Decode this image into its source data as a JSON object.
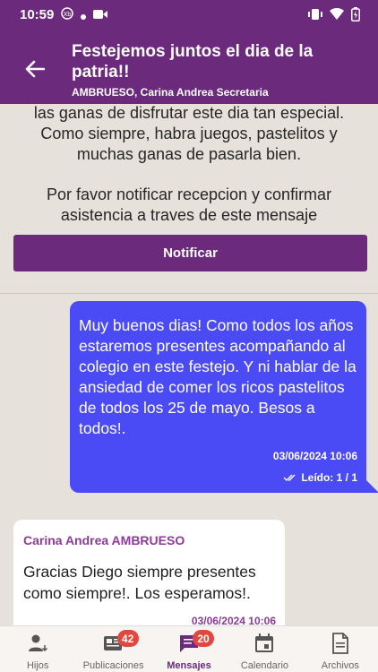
{
  "status_bar": {
    "time": "10:59"
  },
  "header": {
    "title": "Festejemos juntos el dia de la patria!!",
    "subtitle": "AMBRUESO, Carina Andrea Secretaria"
  },
  "announcement": {
    "text_partial": "las ganas de disfrutar este dia tan especial. Como siempre, habra juegos, pastelitos y muchas ganas de pasarla bien.",
    "text_request": "Por favor notificar recepcion y confirmar asistencia a traves de este mensaje",
    "notify_button_label": "Notificar"
  },
  "messages": [
    {
      "direction": "outgoing",
      "text": "Muy buenos dias! Como todos los años estaremos presentes acompañando al colegio en este festejo. Y ni hablar de la ansiedad de comer los ricos pastelitos de todos los 25 de mayo. Besos a todos!.",
      "date": "03/06/2024 10:06",
      "read_status": "Leído: 1 / 1"
    },
    {
      "direction": "incoming",
      "sender": "Carina Andrea AMBRUESO",
      "text": "Gracias Diego siempre presentes como siempre!. Los esperamos!.",
      "date": "03/06/2024 10:06"
    }
  ],
  "bottom_nav": [
    {
      "label": "Hijos",
      "icon": "child-user-icon",
      "active": false
    },
    {
      "label": "Publicaciones",
      "icon": "newspaper-icon",
      "badge": "42",
      "active": false
    },
    {
      "label": "Mensajes",
      "icon": "chat-icon",
      "badge": "20",
      "active": true
    },
    {
      "label": "Calendario",
      "icon": "calendar-icon",
      "active": false
    },
    {
      "label": "Archivos",
      "icon": "file-icon",
      "active": false
    }
  ],
  "colors": {
    "primary": "#6b2a7b",
    "outgoing_bubble": "#4b4bf5",
    "background": "#e7e1dc",
    "badge": "#e2473e",
    "sender_name": "#8e3a9a"
  }
}
